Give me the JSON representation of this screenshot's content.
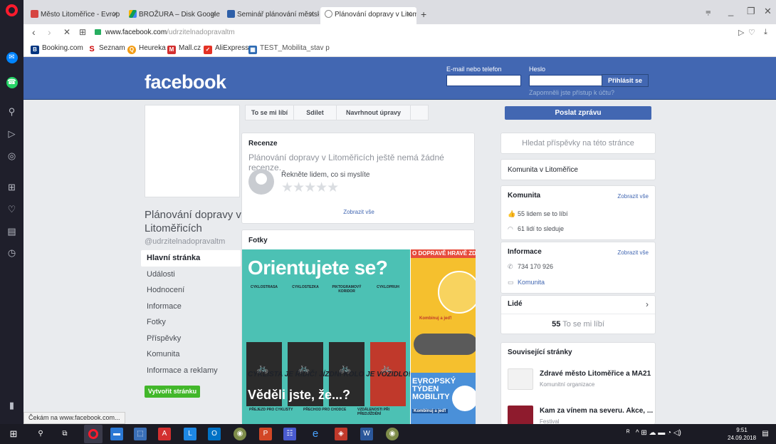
{
  "browser": {
    "tabs": [
      {
        "title": "Město Litoměřice - Evrop",
        "active": false
      },
      {
        "title": "BROŽURA – Disk Google",
        "active": false
      },
      {
        "title": "Seminář plánování městsk",
        "active": false
      },
      {
        "title": "Plánování dopravy v Litom",
        "active": true
      }
    ],
    "new_tab": "+",
    "url_host": "www.facebook.com",
    "url_path": "/udrzitelnadopravaltm",
    "bookmarks": [
      "Booking.com",
      "Seznam",
      "Heureka",
      "Mall.cz",
      "AliExpress",
      "TEST_Mobilita_stav p"
    ],
    "status": "Čekám na www.facebook.com..."
  },
  "fb": {
    "logo": "facebook",
    "email_label": "E-mail nebo telefon",
    "password_label": "Heslo",
    "login_button": "Přihlásit se",
    "forgot": "Zapomněli jste přístup k účtu?"
  },
  "page": {
    "name": "Plánování dopravy v Litoměřicích",
    "handle": "@udrzitelnadopravaltm",
    "nav": [
      "Hlavní stránka",
      "Události",
      "Hodnocení",
      "Informace",
      "Fotky",
      "Příspěvky",
      "Komunita",
      "Informace a reklamy"
    ],
    "create_page": "Vytvořit stránku",
    "actions": [
      "To se mi líbí",
      "Sdílet",
      "Navrhnout úpravy"
    ],
    "send_message": "Poslat zprávu"
  },
  "reviews": {
    "title": "Recenze",
    "empty": "Plánování dopravy v Litoměřicích ještě nemá žádné recenze.",
    "prompt": "Řekněte lidem, co si myslíte",
    "stars": "★★★★★",
    "show_all": "Zobrazit vše"
  },
  "photos": {
    "title": "Fotky",
    "poster_title": "Orientujete se?",
    "poster_columns": [
      "CYKLOSTRASA",
      "CYKLOSTEZKA",
      "PIKTOGRAMOVÝ KORIDOR",
      "CYKLOPRUH"
    ],
    "poster_slogan": "CYKLISTA JE ŘIDIČ!   JÍZDNÍ KOLO JE VOZIDLO!",
    "poster_question": "Věděli jste, že...?",
    "poster_boxes": [
      "PŘEJEZD PRO CYKLISTY",
      "PŘECHOD PRO CHODCE",
      "VZDÁLENOSTI PŘI PŘEDJÍŽDĚNÍ"
    ],
    "side_top_title": "O DOPRAVĚ HRAVĚ ZDRAVĚ",
    "side_top_note": "Kombinuj a jeď!",
    "side_bot_title": "EVROPSKÝ TÝDEN MOBILITY",
    "side_bot_note": "Kombinuj a jeď!"
  },
  "sidebar": {
    "search_placeholder": "Hledat příspěvky na této stránce",
    "community_location": "Komunita v Litoměřice",
    "community_title": "Komunita",
    "see_all": "Zobrazit vše",
    "likes": "55 lidem se to líbí",
    "follows": "61 lidí to sleduje",
    "info_title": "Informace",
    "phone": "734 170 926",
    "category": "Komunita",
    "people_title": "Lidé",
    "people_count": "55",
    "people_likes_label": "To se mi líbí",
    "related_title": "Související stránky",
    "related": [
      {
        "name": "Zdravé město Litoměřice a MA21",
        "category": "Komunitní organizace"
      },
      {
        "name": "Kam za vínem na severu. Akce, ...",
        "category": "Festival"
      }
    ]
  },
  "taskbar": {
    "time": "9:51",
    "date": "24.09.2018"
  }
}
